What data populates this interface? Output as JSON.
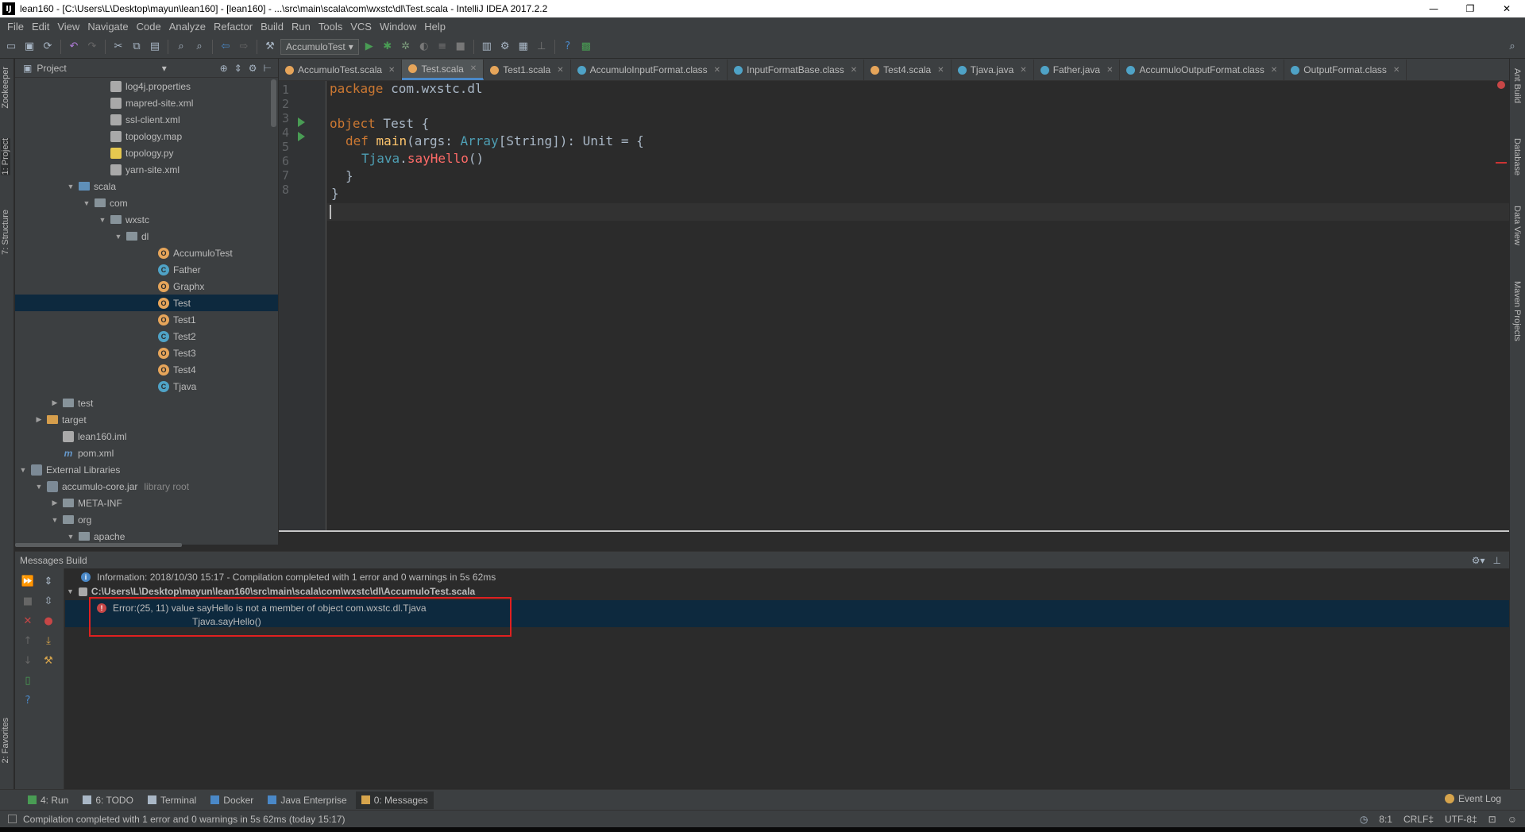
{
  "window": {
    "title": "lean160 - [C:\\Users\\L\\Desktop\\mayun\\lean160] - [lean160] - ...\\src\\main\\scala\\com\\wxstc\\dl\\Test.scala - IntelliJ IDEA 2017.2.2",
    "logo": "IJ",
    "minimize": "—",
    "restore": "❐",
    "close": "✕"
  },
  "menu": [
    "File",
    "Edit",
    "View",
    "Navigate",
    "Code",
    "Analyze",
    "Refactor",
    "Build",
    "Run",
    "Tools",
    "VCS",
    "Window",
    "Help"
  ],
  "toolbar": {
    "run_config": "AccumuloTest"
  },
  "left_strip": {
    "zookeeper": "Zookeeper",
    "project": "1: Project",
    "structure": "7: Structure",
    "favorites": "2: Favorites"
  },
  "right_strip": {
    "ant": "Ant Build",
    "database": "Database",
    "dataview": "Data View",
    "maven": "Maven Projects"
  },
  "project": {
    "header": "Project",
    "tree": [
      {
        "label": "log4j.properties",
        "indent": 5,
        "icon": "file",
        "arrow": ""
      },
      {
        "label": "mapred-site.xml",
        "indent": 5,
        "icon": "file",
        "arrow": ""
      },
      {
        "label": "ssl-client.xml",
        "indent": 5,
        "icon": "file",
        "arrow": ""
      },
      {
        "label": "topology.map",
        "indent": 5,
        "icon": "file",
        "arrow": ""
      },
      {
        "label": "topology.py",
        "indent": 5,
        "icon": "py",
        "arrow": ""
      },
      {
        "label": "yarn-site.xml",
        "indent": 5,
        "icon": "file",
        "arrow": ""
      },
      {
        "label": "scala",
        "indent": 3,
        "icon": "folder blue",
        "arrow": "▼"
      },
      {
        "label": "com",
        "indent": 4,
        "icon": "folder",
        "arrow": "▼"
      },
      {
        "label": "wxstc",
        "indent": 5,
        "icon": "folder",
        "arrow": "▼"
      },
      {
        "label": "dl",
        "indent": 6,
        "icon": "folder",
        "arrow": "▼"
      },
      {
        "label": "AccumuloTest",
        "indent": 8,
        "icon": "obj",
        "arrow": ""
      },
      {
        "label": "Father",
        "indent": 8,
        "icon": "cls",
        "arrow": ""
      },
      {
        "label": "Graphx",
        "indent": 8,
        "icon": "obj",
        "arrow": ""
      },
      {
        "label": "Test",
        "indent": 8,
        "icon": "obj",
        "arrow": "",
        "selected": true
      },
      {
        "label": "Test1",
        "indent": 8,
        "icon": "obj",
        "arrow": ""
      },
      {
        "label": "Test2",
        "indent": 8,
        "icon": "cls",
        "arrow": ""
      },
      {
        "label": "Test3",
        "indent": 8,
        "icon": "obj",
        "arrow": ""
      },
      {
        "label": "Test4",
        "indent": 8,
        "icon": "obj",
        "arrow": ""
      },
      {
        "label": "Tjava",
        "indent": 8,
        "icon": "cls",
        "arrow": ""
      },
      {
        "label": "test",
        "indent": 2,
        "icon": "folder",
        "arrow": "▶"
      },
      {
        "label": "target",
        "indent": 1,
        "icon": "folder orange",
        "arrow": "▶"
      },
      {
        "label": "lean160.iml",
        "indent": 2,
        "icon": "file",
        "arrow": ""
      },
      {
        "label": "pom.xml",
        "indent": 2,
        "icon": "maven",
        "arrow": ""
      },
      {
        "label": "External Libraries",
        "indent": 0,
        "icon": "lib",
        "arrow": "▼"
      },
      {
        "label": "accumulo-core.jar",
        "indent": 1,
        "icon": "lib",
        "arrow": "▼",
        "hint": "library root"
      },
      {
        "label": "META-INF",
        "indent": 2,
        "icon": "folder",
        "arrow": "▶"
      },
      {
        "label": "org",
        "indent": 2,
        "icon": "folder",
        "arrow": "▼"
      },
      {
        "label": "apache",
        "indent": 3,
        "icon": "folder",
        "arrow": "▼"
      }
    ]
  },
  "tabs": [
    {
      "label": "AccumuloTest.scala",
      "icon": "s"
    },
    {
      "label": "Test.scala",
      "icon": "s",
      "active": true
    },
    {
      "label": "Test1.scala",
      "icon": "s"
    },
    {
      "label": "AccumuloInputFormat.class",
      "icon": "c"
    },
    {
      "label": "InputFormatBase.class",
      "icon": "c"
    },
    {
      "label": "Test4.scala",
      "icon": "s"
    },
    {
      "label": "Tjava.java",
      "icon": "j"
    },
    {
      "label": "Father.java",
      "icon": "c"
    },
    {
      "label": "AccumuloOutputFormat.class",
      "icon": "c"
    },
    {
      "label": "OutputFormat.class",
      "icon": "c"
    }
  ],
  "editor": {
    "line_numbers": [
      "1",
      "2",
      "3",
      "4",
      "5",
      "6",
      "7",
      "8"
    ],
    "code": {
      "l1_kw": "package",
      "l1_rest": " com.wxstc.dl",
      "l3_kw": "object",
      "l3_rest": " Test {",
      "l4_kw": "def",
      "l4_fn": "main",
      "l4_a": "(args: ",
      "l4_ty1": "Array",
      "l4_b": "[String]): Unit = {",
      "l5_obj": "Tjava",
      "l5_dot": ".",
      "l5_err": "sayHello",
      "l5_end": "()",
      "l6": "}",
      "l7": "}"
    }
  },
  "messages": {
    "header": "Messages Build",
    "info": "Information: 2018/10/30 15:17 - Compilation completed with 1 error and 0 warnings in 5s 62ms",
    "file": "C:\\Users\\L\\Desktop\\mayun\\lean160\\src\\main\\scala\\com\\wxstc\\dl\\AccumuloTest.scala",
    "error_line1": "Error:(25, 11)  value sayHello is not a member of object com.wxstc.dl.Tjava",
    "error_line2": "Tjava.sayHello()"
  },
  "bottom_tools": [
    {
      "label": "4: Run",
      "color": "#499c54"
    },
    {
      "label": "6: TODO",
      "color": "#a9b7c6"
    },
    {
      "label": "Terminal",
      "color": "#a9b7c6"
    },
    {
      "label": "Docker",
      "color": "#4a88c7"
    },
    {
      "label": "Java Enterprise",
      "color": "#4a88c7"
    },
    {
      "label": "0: Messages",
      "color": "#d6a44c",
      "active": true
    }
  ],
  "event_log": "Event Log",
  "status": {
    "message": "Compilation completed with 1 error and 0 warnings in 5s 62ms (today 15:17)",
    "position": "8:1",
    "line_sep": "CRLF‡",
    "encoding": "UTF-8‡"
  }
}
